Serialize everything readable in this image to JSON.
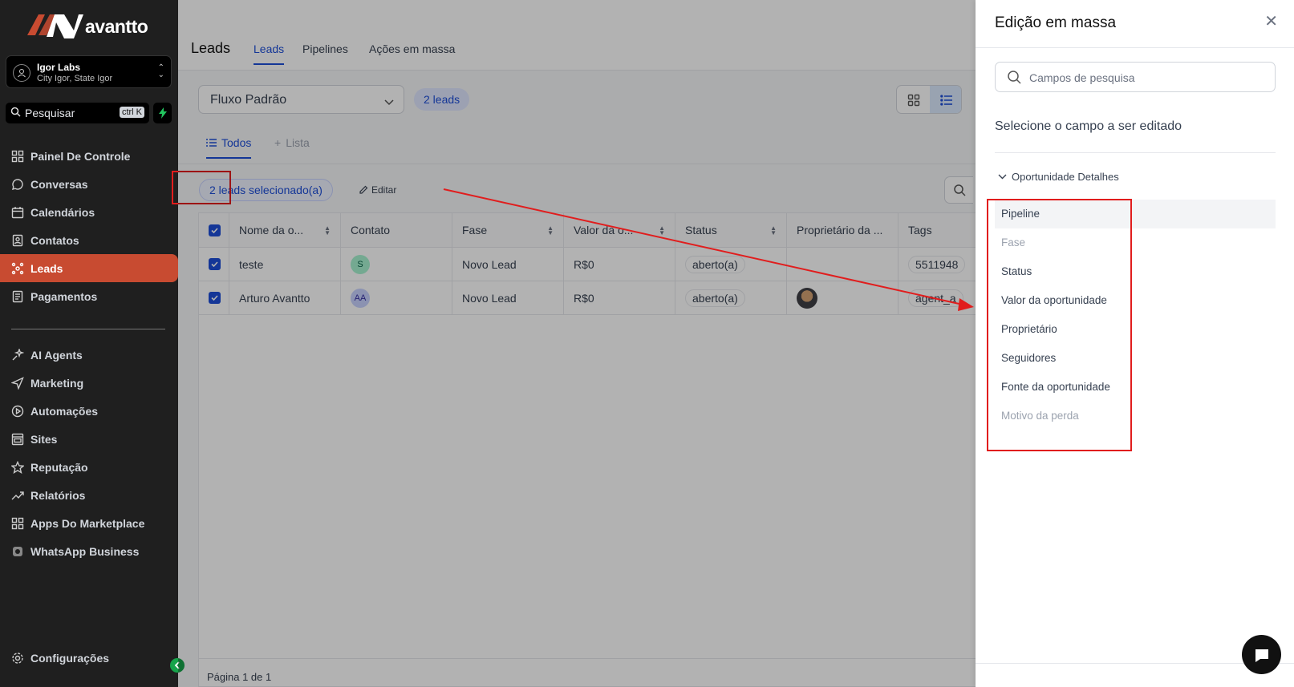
{
  "brand": {
    "name": "avantto",
    "accent": "#c84b31"
  },
  "account": {
    "name": "Igor Labs",
    "location": "City Igor, State Igor"
  },
  "sidebar_search": {
    "placeholder": "Pesquisar",
    "shortcut": "ctrl K"
  },
  "sidebar": {
    "items": [
      {
        "label": "Painel De Controle",
        "icon": "dashboard-icon"
      },
      {
        "label": "Conversas",
        "icon": "chat-icon"
      },
      {
        "label": "Calendários",
        "icon": "calendar-icon"
      },
      {
        "label": "Contatos",
        "icon": "contacts-icon"
      },
      {
        "label": "Leads",
        "icon": "leads-icon",
        "active": true
      },
      {
        "label": "Pagamentos",
        "icon": "payments-icon"
      },
      {
        "label": "AI Agents",
        "icon": "sparkle-icon"
      },
      {
        "label": "Marketing",
        "icon": "send-icon"
      },
      {
        "label": "Automações",
        "icon": "play-icon"
      },
      {
        "label": "Sites",
        "icon": "sites-icon"
      },
      {
        "label": "Reputação",
        "icon": "star-icon"
      },
      {
        "label": "Relatórios",
        "icon": "trend-icon"
      },
      {
        "label": "Apps Do Marketplace",
        "icon": "apps-icon"
      },
      {
        "label": "WhatsApp Business",
        "icon": "whatsapp-icon"
      }
    ],
    "settings_label": "Configurações"
  },
  "header": {
    "title": "Leads",
    "tabs": [
      "Leads",
      "Pipelines",
      "Ações em massa"
    ]
  },
  "pipeline_select": {
    "value": "Fluxo Padrão"
  },
  "lead_count": "2 leads",
  "filter_tabs": {
    "todos": "Todos",
    "lista": "Lista"
  },
  "selection": {
    "badge": "2 leads selecionado(a)",
    "edit_label": "Editar"
  },
  "table": {
    "columns": [
      "Nome da o...",
      "Contato",
      "Fase",
      "Valor da o...",
      "Status",
      "Proprietário da ...",
      "Tags"
    ],
    "rows": [
      {
        "name": "teste",
        "contact_initials": "S",
        "stage": "Novo Lead",
        "value": "R$0",
        "status": "aberto(a)",
        "owner": "",
        "tags": "5511948"
      },
      {
        "name": "Arturo Avantto",
        "contact_initials": "AA",
        "stage": "Novo Lead",
        "value": "R$0",
        "status": "aberto(a)",
        "owner": "photo",
        "tags": "agent_a"
      }
    ],
    "footer": "Página 1 de 1"
  },
  "drawer": {
    "title": "Edição em massa",
    "search_placeholder": "Campos de pesquisa",
    "subtitle": "Selecione o campo a ser editado",
    "group": "Oportunidade Detalhes",
    "fields": [
      {
        "label": "Pipeline",
        "enabled": true
      },
      {
        "label": "Fase",
        "enabled": false
      },
      {
        "label": "Status",
        "enabled": true
      },
      {
        "label": "Valor da oportunidade",
        "enabled": true
      },
      {
        "label": "Proprietário",
        "enabled": true
      },
      {
        "label": "Seguidores",
        "enabled": true
      },
      {
        "label": "Fonte da oportunidade",
        "enabled": true
      },
      {
        "label": "Motivo da perda",
        "enabled": false
      }
    ]
  },
  "annotation_color": "#e11d1d"
}
